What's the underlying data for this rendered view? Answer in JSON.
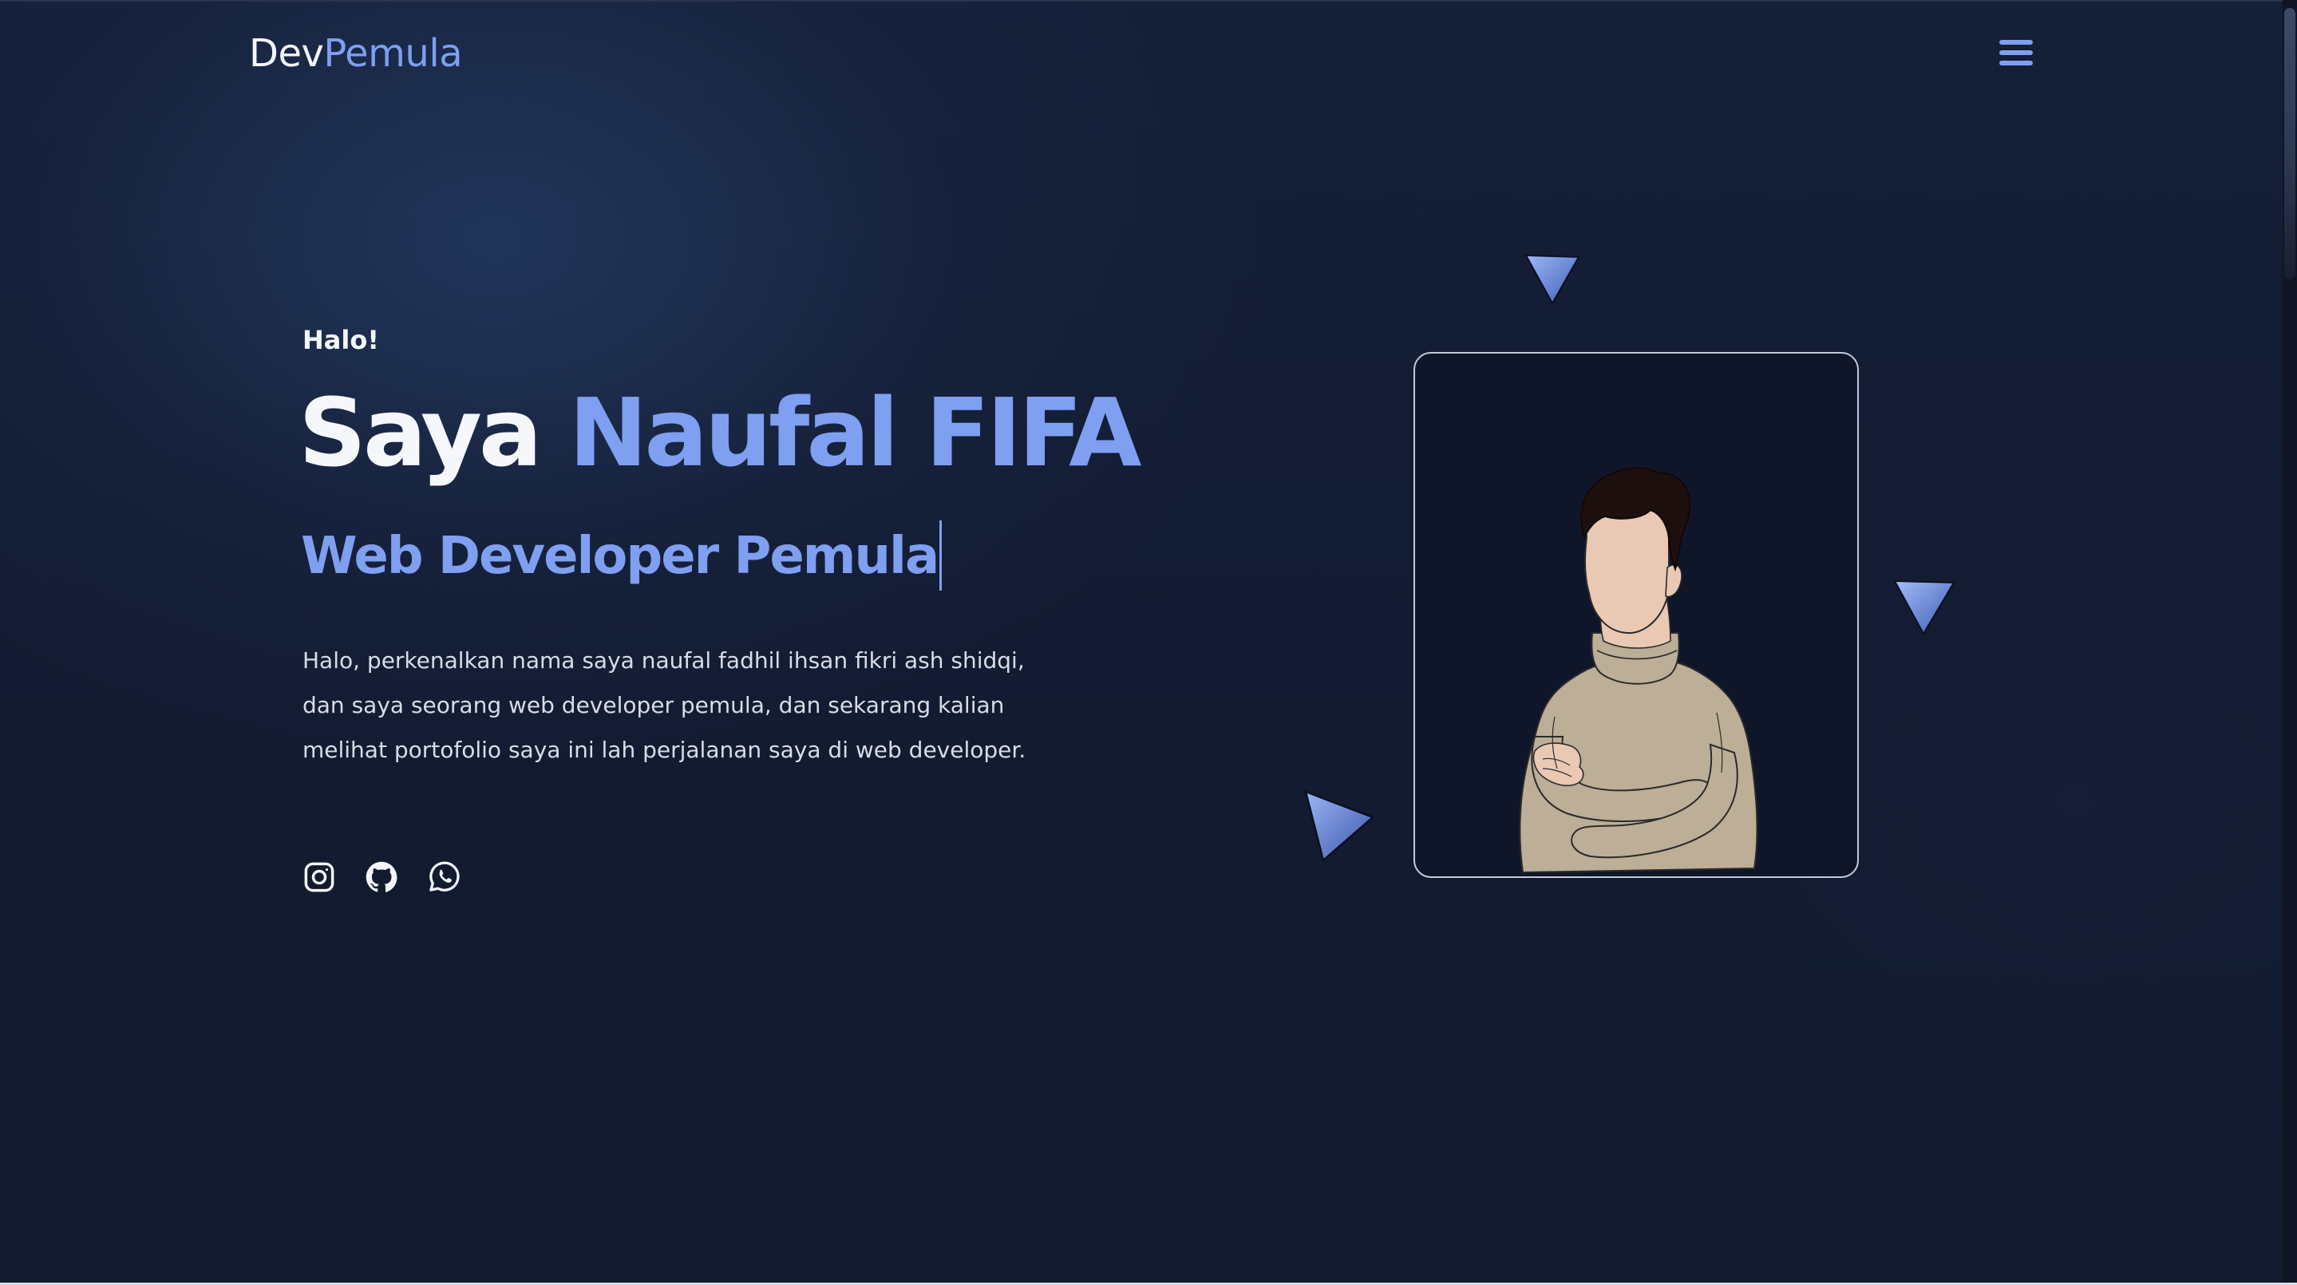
{
  "navbar": {
    "logo_part1": "Dev",
    "logo_part2": "Pemula",
    "menu_icon": "hamburger-menu-icon"
  },
  "hero": {
    "greeting": "Halo!",
    "headline_prefix": "Saya",
    "headline_name": "Naufal FIFA",
    "role": "Web Developer Pemula",
    "intro": "Halo, perkenalkan nama saya naufal fadhil ihsan fikri ash shidqi, dan saya seorang web developer pemula, dan sekarang kalian melihat portofolio saya ini lah perjalanan saya di web developer."
  },
  "socials": [
    {
      "icon": "instagram-icon"
    },
    {
      "icon": "github-icon"
    },
    {
      "icon": "whatsapp-icon"
    }
  ],
  "colors": {
    "background": "#111a2e",
    "accent": "#7f9ff1",
    "text": "#f4f6fb",
    "body_text": "#d8dce6",
    "card_border": "#c3cada"
  }
}
